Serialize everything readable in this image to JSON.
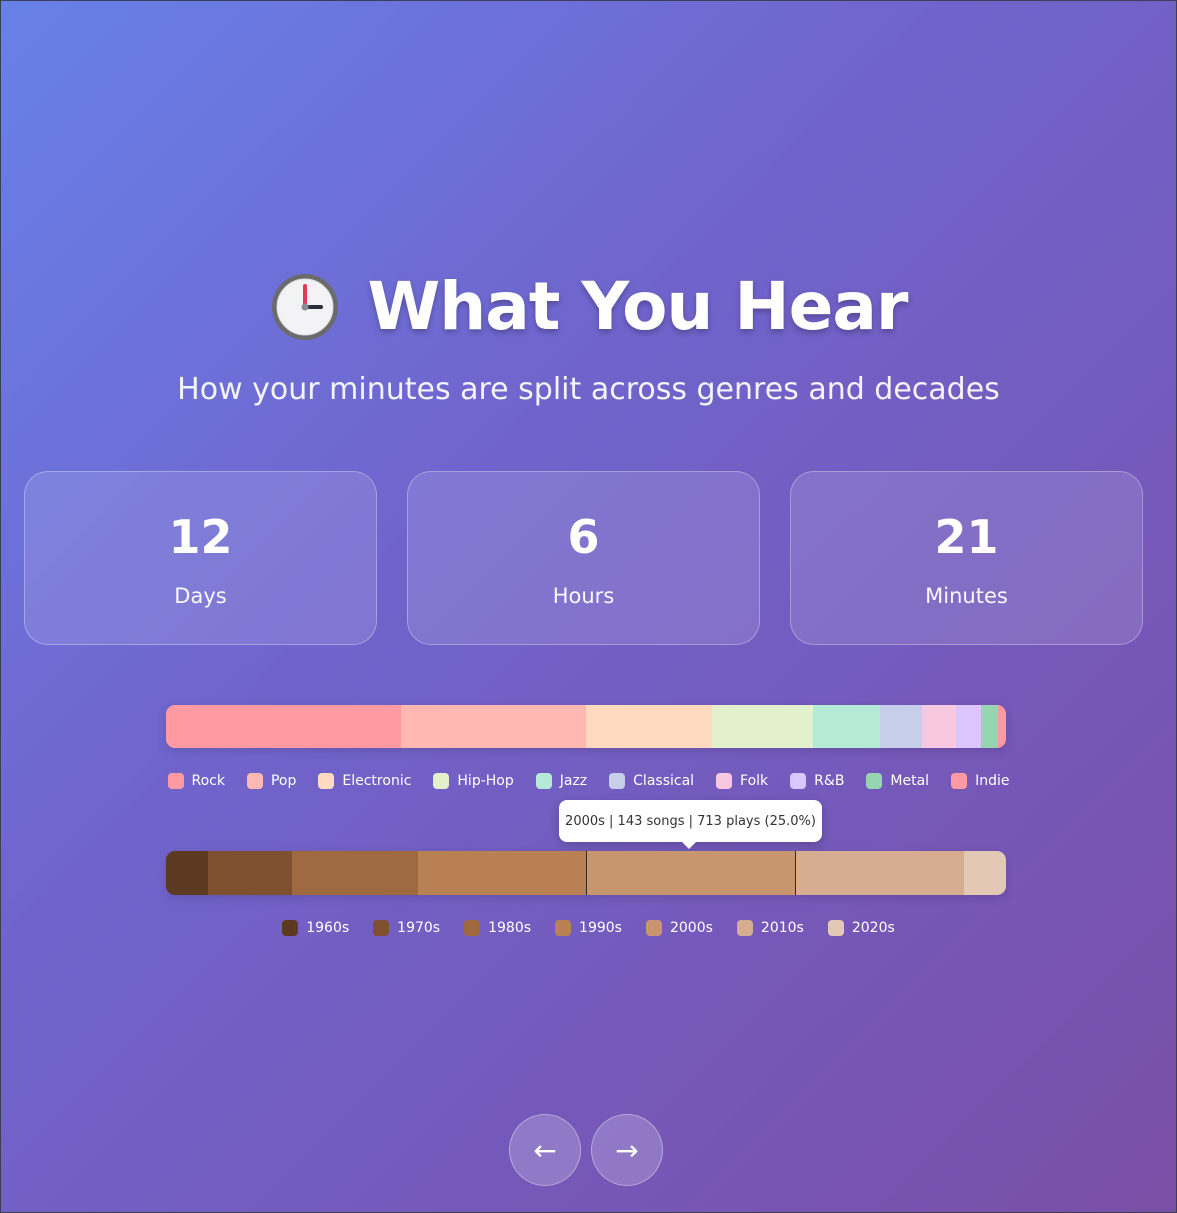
{
  "header": {
    "icon": "clock-icon",
    "title": "What You Hear",
    "subtitle": "How your minutes are split across genres and decades"
  },
  "stats": [
    {
      "value": "12",
      "label": "Days"
    },
    {
      "value": "6",
      "label": "Hours"
    },
    {
      "value": "21",
      "label": "Minutes"
    }
  ],
  "chart_data": [
    {
      "type": "bar",
      "orientation": "horizontal-stacked",
      "categories": [
        "Rock",
        "Pop",
        "Electronic",
        "Hip-Hop",
        "Jazz",
        "Classical",
        "Folk",
        "R&B",
        "Metal",
        "Indie"
      ],
      "values": [
        28,
        22,
        15,
        12,
        8,
        5,
        4,
        3,
        2,
        1
      ],
      "unit": "percent of listening",
      "colors": [
        "#ff9aa2",
        "#ffb7b2",
        "#ffdac1",
        "#e2f0cb",
        "#b5ead7",
        "#c7ceea",
        "#f8c8e0",
        "#dcc6ff",
        "#95d5b2",
        "#ff9aa2"
      ],
      "legend": "bottom-center"
    },
    {
      "type": "bar",
      "orientation": "horizontal-stacked",
      "categories": [
        "1960s",
        "1970s",
        "1980s",
        "1990s",
        "2000s",
        "2010s",
        "2020s"
      ],
      "values": [
        5,
        10,
        15,
        20,
        25,
        20,
        5
      ],
      "unit": "percent of plays",
      "colors": [
        "#5c3a21",
        "#7f5030",
        "#a06a40",
        "#b88053",
        "#c8966e",
        "#d6ad90",
        "#e2c8b5"
      ],
      "legend": "bottom-center",
      "hovered": {
        "category": "2000s",
        "tooltip": "2000s | 143 songs | 713 plays (25.0%)"
      }
    }
  ],
  "navigation": {
    "prev_label": "←",
    "next_label": "→"
  }
}
